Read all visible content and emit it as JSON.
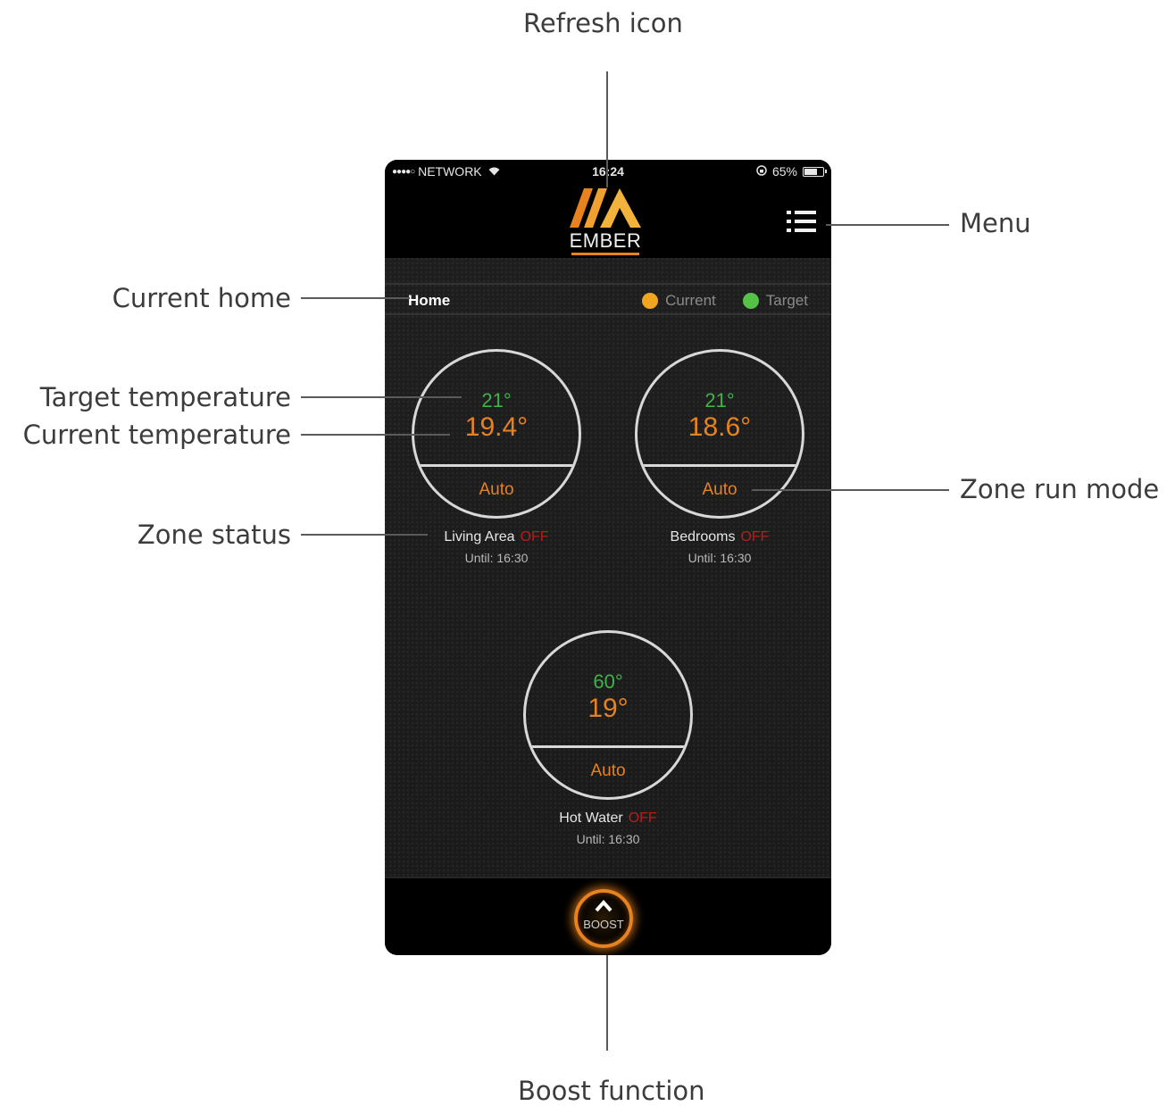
{
  "callouts": {
    "refresh_icon": "Refresh icon",
    "menu": "Menu",
    "current_home": "Current home",
    "target_temperature": "Target temperature",
    "current_temperature": "Current temperature",
    "zone_status": "Zone status",
    "zone_run_mode": "Zone run mode",
    "boost_function": "Boost function"
  },
  "status_bar": {
    "signal": "●●●●○",
    "carrier": "NETWORK",
    "time": "16:24",
    "battery_text": "65%",
    "battery_level": 0.65
  },
  "header": {
    "brand": "EMBER",
    "menu_icon": "menu-list-icon"
  },
  "home_bar": {
    "home_label": "Home",
    "legend_current": "Current",
    "legend_target": "Target"
  },
  "colors": {
    "current": "#e8821e",
    "target": "#3fb24a",
    "off": "#b81c1c",
    "background": "#1c1c1c"
  },
  "zones": [
    {
      "target": "21°",
      "current": "19.4°",
      "mode": "Auto",
      "name": "Living Area",
      "state": "OFF",
      "until": "Until: 16:30"
    },
    {
      "target": "21°",
      "current": "18.6°",
      "mode": "Auto",
      "name": "Bedrooms",
      "state": "OFF",
      "until": "Until: 16:30"
    },
    {
      "target": "60°",
      "current": "19°",
      "mode": "Auto",
      "name": "Hot Water",
      "state": "OFF",
      "until": "Until: 16:30"
    }
  ],
  "footer": {
    "boost_label": "BOOST",
    "boost_icon": "chevron-up-icon"
  }
}
